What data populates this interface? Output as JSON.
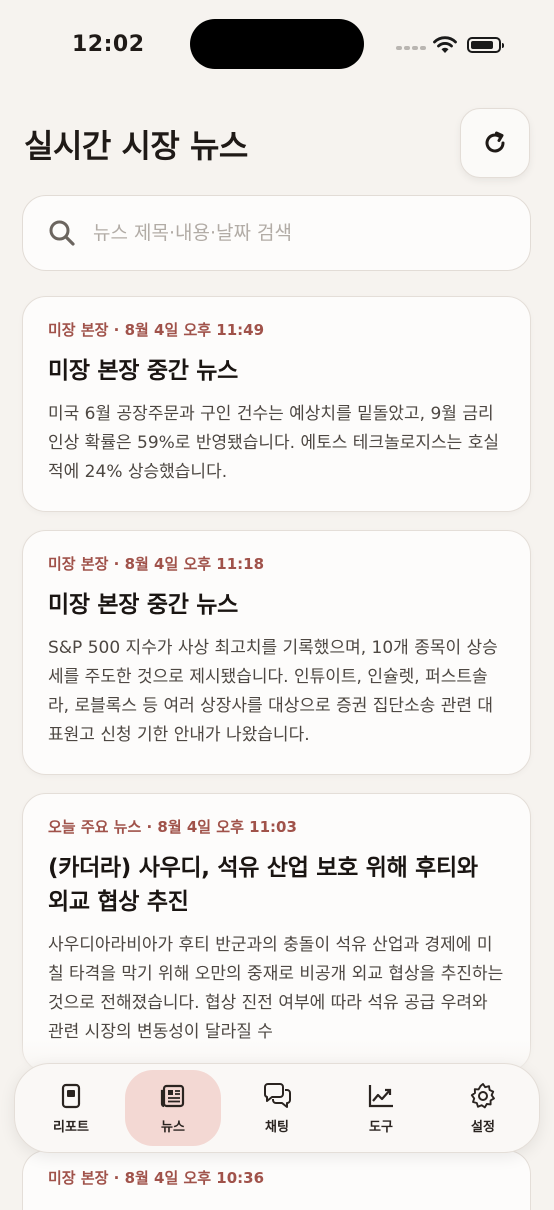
{
  "status": {
    "time": "12:02",
    "battery_level": 0.85
  },
  "header": {
    "title": "실시간 시장 뉴스"
  },
  "search": {
    "placeholder": "뉴스 제목·내용·날짜 검색",
    "value": ""
  },
  "news": [
    {
      "meta": "미장 본장 · 8월 4일 오후 11:49",
      "title": "미장 본장 중간 뉴스",
      "body": "미국 6월 공장주문과 구인 건수는 예상치를 밑돌았고, 9월 금리 인상 확률은 59%로 반영됐습니다. 에토스 테크놀로지스는 호실적에 24% 상승했습니다."
    },
    {
      "meta": "미장 본장 · 8월 4일 오후 11:18",
      "title": "미장 본장 중간 뉴스",
      "body": "S&P 500 지수가 사상 최고치를 기록했으며, 10개 종목이 상승세를 주도한 것으로 제시됐습니다. 인튜이트, 인슐렛, 퍼스트솔라, 로블록스 등 여러 상장사를 대상으로 증권 집단소송 관련 대표원고 신청 기한 안내가 나왔습니다."
    },
    {
      "meta": "오늘 주요 뉴스 · 8월 4일 오후 11:03",
      "title": "(카더라) 사우디, 석유 산업 보호 위해 후티와 외교 협상 추진",
      "body": "사우디아라비아가 후티 반군과의 충돌이 석유 산업과 경제에 미칠 타격을 막기 위해 오만의 중재로 비공개 외교 협상을 추진하는 것으로 전해졌습니다. 협상 진전 여부에 따라 석유 공급 우려와 관련 시장의 변동성이 달라질 수"
    }
  ],
  "peek": {
    "meta": "미장 본장 · 8월 4일 오후 10:36"
  },
  "tabs": [
    {
      "label": "리포트",
      "icon": "report-icon"
    },
    {
      "label": "뉴스",
      "icon": "newspaper-icon",
      "active": true
    },
    {
      "label": "채팅",
      "icon": "chat-icon"
    },
    {
      "label": "도구",
      "icon": "chart-tool-icon"
    },
    {
      "label": "설정",
      "icon": "gear-icon"
    }
  ],
  "colors": {
    "accent": "#a0524a",
    "active_tab_bg": "#f3d8d3",
    "background": "#f6f3ef"
  }
}
